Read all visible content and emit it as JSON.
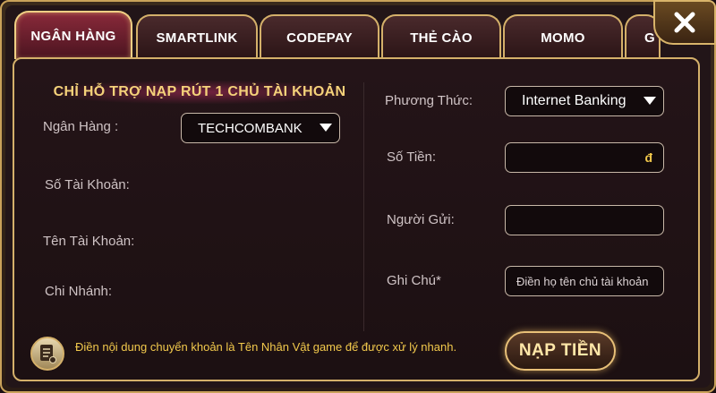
{
  "tabs": [
    {
      "label": "NGÂN HÀNG",
      "active": true
    },
    {
      "label": "SMARTLINK"
    },
    {
      "label": "CODEPAY"
    },
    {
      "label": "THẺ CÀO"
    },
    {
      "label": "MOMO"
    },
    {
      "label": "G"
    }
  ],
  "close_icon": "close-x-icon",
  "notice": "CHỈ HỖ TRỢ NẠP RÚT 1 CHỦ TÀI KHOẢN",
  "left": {
    "bank_label": "Ngân Hàng :",
    "bank_value": "TECHCOMBANK",
    "account_number_label": "Số Tài Khoản:",
    "account_name_label": "Tên Tài Khoản:",
    "branch_label": "Chi Nhánh:"
  },
  "right": {
    "method_label": "Phương Thức:",
    "method_value": "Internet Banking",
    "amount_label": "Số Tiền:",
    "amount_currency": "đ",
    "sender_label": "Người Gửi:",
    "note_label": "Ghi Chú*",
    "note_placeholder": "Điền họ tên chủ tài khoản"
  },
  "footer": {
    "info": "Điền nội dung chuyển khoản là Tên Nhân Vật game để được xử lý nhanh.",
    "submit_label": "NẠP TIỀN"
  },
  "colors": {
    "gold": "#d4b06a",
    "accent_text": "#f2c94c",
    "active_tab": "#8a2a3a"
  }
}
